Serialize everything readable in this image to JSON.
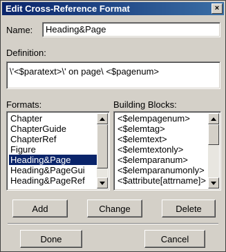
{
  "window": {
    "title": "Edit Cross-Reference Format",
    "close_glyph": "×"
  },
  "name": {
    "label": "Name:",
    "value": "Heading&Page"
  },
  "definition": {
    "label": "Definition:",
    "value": "\\'<$paratext>\\' on page\\ <$pagenum>"
  },
  "formats": {
    "label": "Formats:",
    "items": [
      "Chapter",
      "ChapterGuide",
      "ChapterRef",
      "Figure",
      "Heading&Page",
      "Heading&PageGui",
      "Heading&PageRef"
    ],
    "selected_index": 4
  },
  "building_blocks": {
    "label": "Building Blocks:",
    "items": [
      "<$elempagenum>",
      "<$elemtag>",
      "<$elemtext>",
      "<$elemtextonly>",
      "<$elemparanum>",
      "<$elemparanumonly>",
      "<$attribute[attrname]>"
    ]
  },
  "buttons": {
    "add": "Add",
    "change": "Change",
    "delete": "Delete",
    "done": "Done",
    "cancel": "Cancel"
  }
}
